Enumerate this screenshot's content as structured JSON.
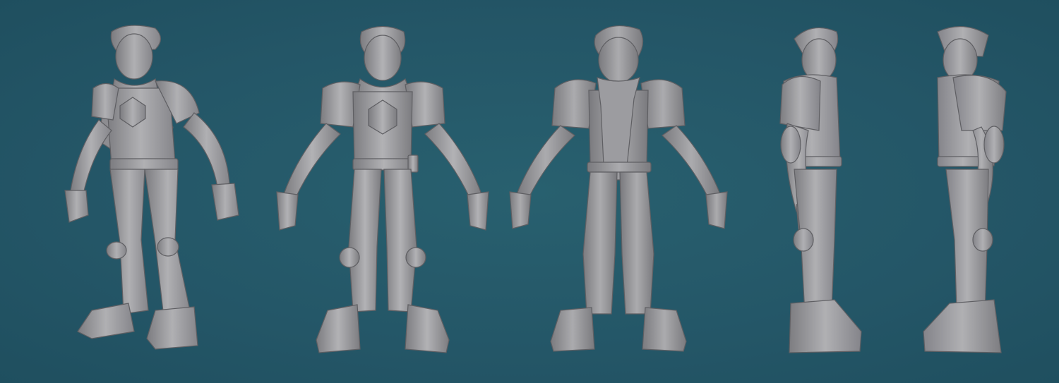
{
  "scene": {
    "background_color": "#245667",
    "model_color": "#9a9a9d",
    "views": [
      {
        "view": "three-quarter-front"
      },
      {
        "view": "front"
      },
      {
        "view": "back"
      },
      {
        "view": "side-left"
      },
      {
        "view": "side-right"
      }
    ]
  }
}
